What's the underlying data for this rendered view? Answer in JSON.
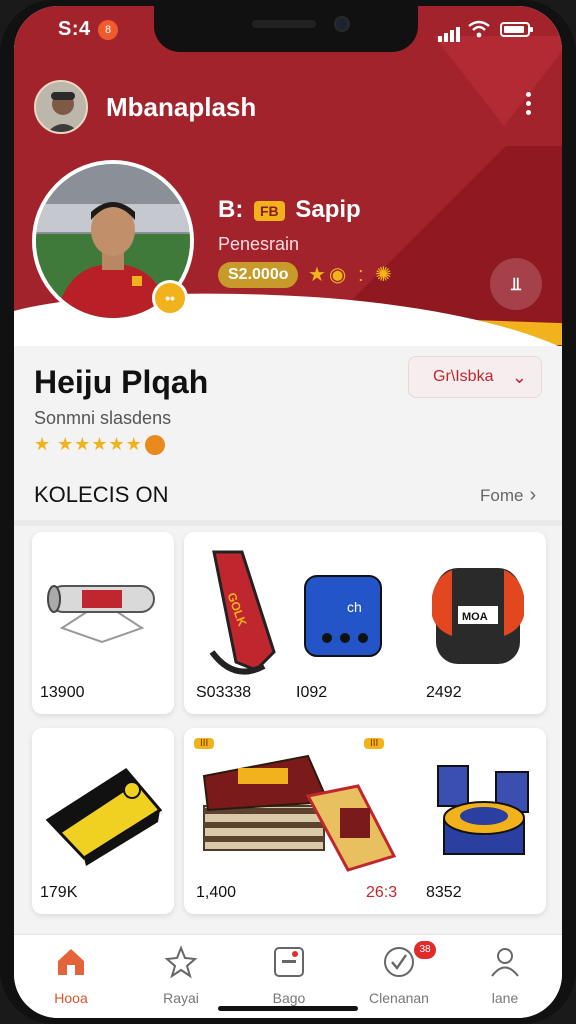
{
  "status": {
    "time": "S:4",
    "indicator": "8"
  },
  "header": {
    "title": "Mbanaplash",
    "avatar": "avatar",
    "more_icon": "more-vertical-icon"
  },
  "profile": {
    "name_prefix": "B:",
    "name_tag": "FB",
    "name_suffix": "Sapip",
    "role": "Penesrain",
    "score": "S2.000o",
    "icons": "★◉ : ✺",
    "badge": "••",
    "stats_button": "⫫"
  },
  "info": {
    "name": "Heiju  Plqah",
    "follow_label": "Gr\\Isbka",
    "subtitle": "Sonmni slasdens",
    "stars": "★ ★★★★★"
  },
  "section": {
    "title": "KOLECIS ON",
    "more_label": "Fome"
  },
  "cards": [
    {
      "price": "13900"
    },
    {
      "price": "S03338"
    },
    {
      "price": "I092"
    },
    {
      "price": "2492"
    },
    {
      "price": "179K"
    },
    {
      "price": "1,400"
    },
    {
      "price": "26:3",
      "price_color": "#c0262e"
    },
    {
      "price": "8352"
    }
  ],
  "card_tags": [
    "III",
    "III"
  ],
  "item_labels": {
    "strap": "GOLK",
    "dice": "ch",
    "bag": "MOA",
    "case": "•••"
  },
  "nav": {
    "items": [
      {
        "label": "Hooa",
        "icon": "home-icon"
      },
      {
        "label": "Rayai",
        "icon": "star-icon"
      },
      {
        "label": "Bago",
        "icon": "card-icon"
      },
      {
        "label": "Clenanan",
        "icon": "check-icon",
        "badge": "38"
      },
      {
        "label": "lane",
        "icon": "person-icon"
      }
    ]
  },
  "colors": {
    "brand": "#a3232c",
    "gold": "#f2b21c",
    "active": "#d8542a"
  }
}
